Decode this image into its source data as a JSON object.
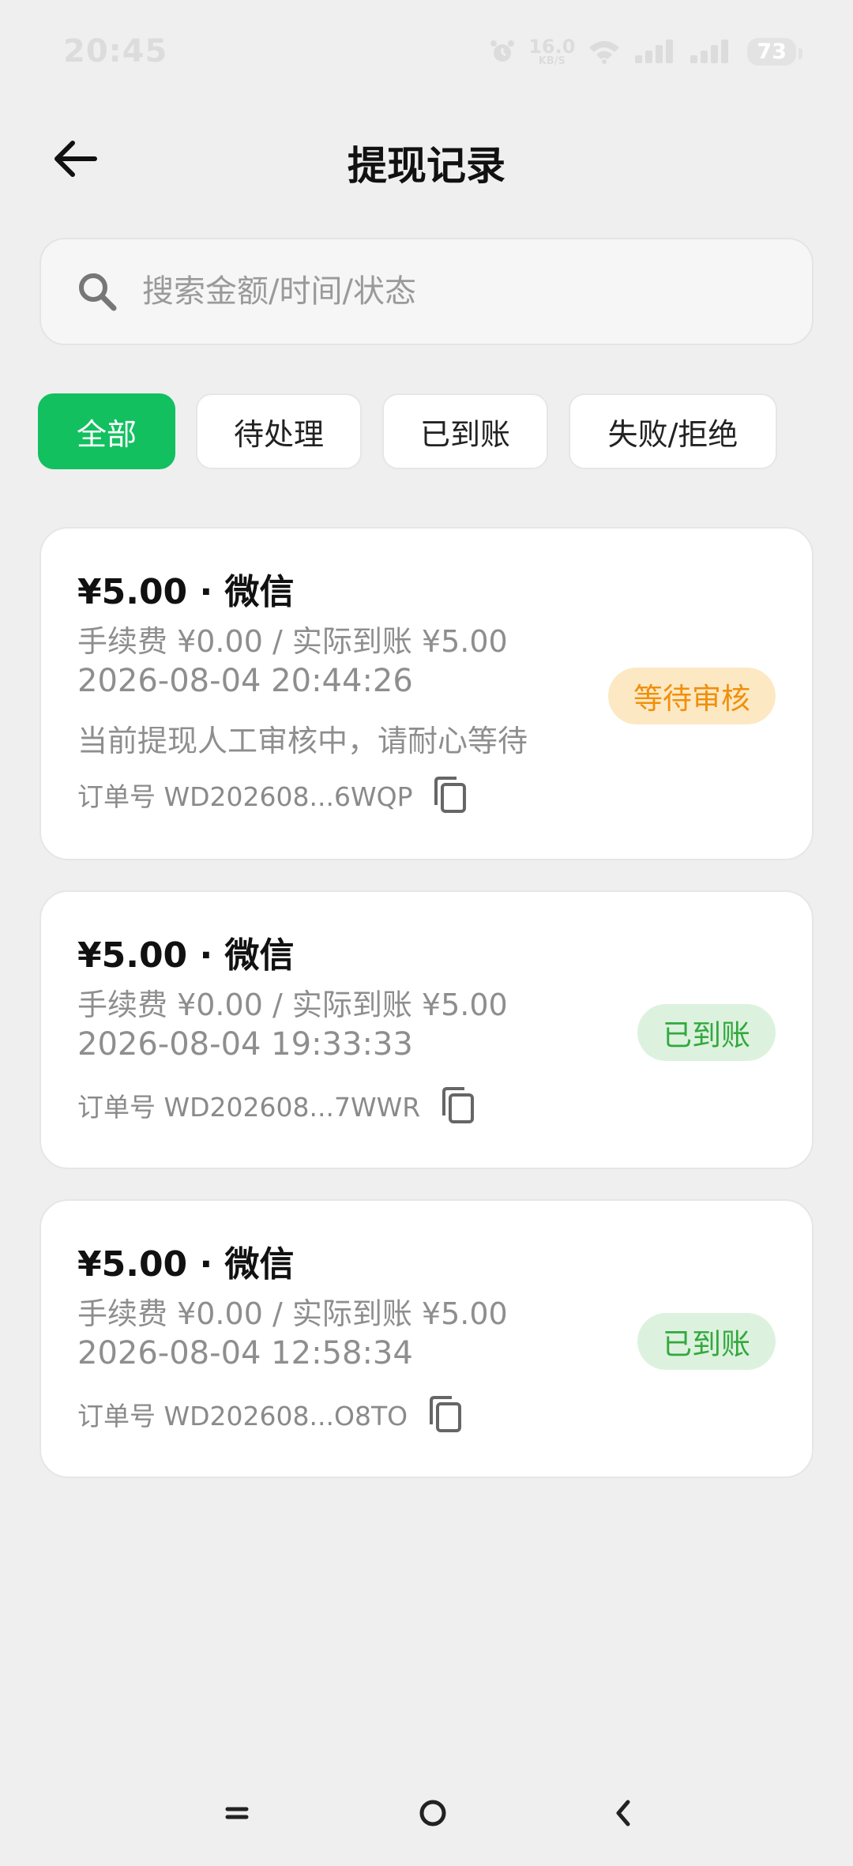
{
  "status_bar": {
    "time": "20:45",
    "net_speed": "16.0",
    "net_unit": "KB/S",
    "battery": "73"
  },
  "header": {
    "title": "提现记录"
  },
  "search": {
    "placeholder": "搜索金额/时间/状态",
    "value": ""
  },
  "filters": [
    {
      "label": "全部",
      "active": true
    },
    {
      "label": "待处理",
      "active": false
    },
    {
      "label": "已到账",
      "active": false
    },
    {
      "label": "失败/拒绝",
      "active": false
    }
  ],
  "records": [
    {
      "amount": "¥5.00 · 微信",
      "fee": "手续费 ¥0.00 / 实际到账 ¥5.00",
      "time": "2026-08-04 20:44:26",
      "note": "当前提现人工审核中，请耐心等待",
      "order": "订单号 WD202608...6WQP",
      "status": "等待审核"
    },
    {
      "amount": "¥5.00 · 微信",
      "fee": "手续费 ¥0.00 / 实际到账 ¥5.00",
      "time": "2026-08-04 19:33:33",
      "order": "订单号 WD202608...7WWR",
      "status": "已到账"
    },
    {
      "amount": "¥5.00 · 微信",
      "fee": "手续费 ¥0.00 / 实际到账 ¥5.00",
      "time": "2026-08-04 12:58:34",
      "order": "订单号 WD202608...O8TO",
      "status": "已到账"
    }
  ],
  "colors": {
    "accent": "#12c060",
    "pending_text": "#f0900a",
    "pending_bg": "#fde8c4",
    "done_text": "#33a83e",
    "done_bg": "#dcf2de"
  }
}
